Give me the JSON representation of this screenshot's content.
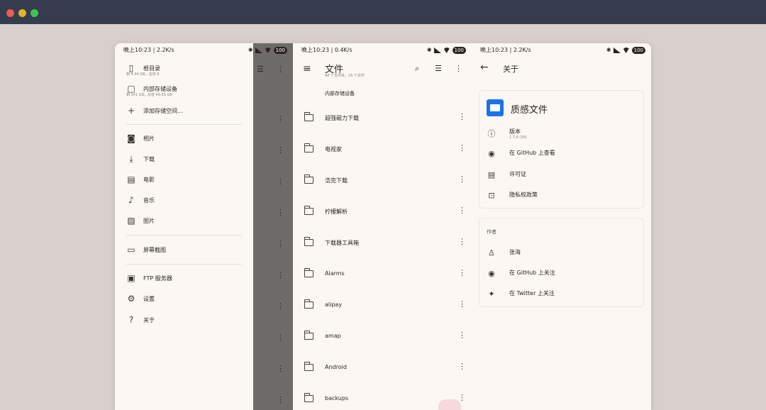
{
  "window": {
    "colors": {
      "titlebar": "#343c4d",
      "close": "#ed5b53",
      "minimize": "#e5b22c",
      "maximize": "#3ec44e"
    }
  },
  "status": {
    "p1": {
      "time": "晚上10:23 | 2.2K/s",
      "battery": "100"
    },
    "p2": {
      "time": "晚上10:23 | 0.4K/s",
      "battery": "100"
    },
    "p3": {
      "time": "晚上10:23 | 2.2K/s",
      "battery": "100"
    }
  },
  "drawer": {
    "storage": [
      {
        "label": "根目录",
        "sub": "剩 4.44 GB，总容 8"
      },
      {
        "label": "内部存储设备",
        "sub": "剩 241 GB，总容 49.63 GB"
      },
      {
        "label": "添加存储空间..."
      }
    ],
    "places": [
      "相片",
      "下载",
      "电影",
      "音乐",
      "图片"
    ],
    "bookmarks": [
      "屏幕截图"
    ],
    "others": [
      "FTP 服务器",
      "设置",
      "关于"
    ]
  },
  "files": {
    "title": "文件",
    "subtitle": "68 个文件夹，16 个文件",
    "breadcrumb": "内部存储设备",
    "folders": [
      "超强磁力下载",
      "电视家",
      "浩克下载",
      "柠檬解析",
      "下载器工具箱",
      "Alarms",
      "alipay",
      "amap",
      "Android",
      "backups"
    ]
  },
  "about": {
    "title": "关于",
    "app_name": "质感文件",
    "version_label": "版本",
    "version_value": "1.7.4 (39)",
    "github_view": "在 GitHub 上查看",
    "license": "许可证",
    "privacy": "隐私权政策",
    "author_section": "作者",
    "author_name": "张海",
    "github_follow": "在 GitHub 上关注",
    "twitter_follow": "在 Twitter 上关注"
  }
}
